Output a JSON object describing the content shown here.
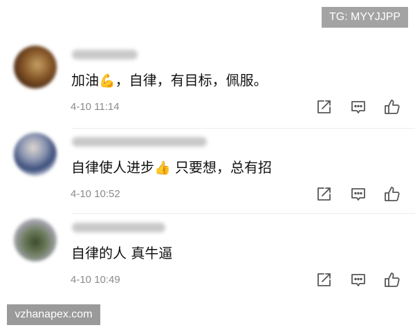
{
  "watermarks": {
    "top": "TG: MYYJJPP",
    "bottom": "vzhanapex.com"
  },
  "comments": [
    {
      "nickname": "",
      "text_before": "加油",
      "emoji": "💪",
      "text_after": "，自律，有目标，佩服。",
      "time": "4-10 11:14"
    },
    {
      "nickname": "",
      "text_before": "自律使人进步",
      "emoji": "👍",
      "text_after": " 只要想，总有招",
      "time": "4-10 10:52"
    },
    {
      "nickname": "",
      "text_before": "自律的人 真牛逼",
      "emoji": "",
      "text_after": "",
      "time": "4-10 10:49"
    }
  ],
  "icons": {
    "share": "share-edit-icon",
    "reply": "comment-icon",
    "like": "thumbs-up-icon"
  },
  "colors": {
    "watermark_bg": "#a3a3a3",
    "timestamp": "#8a8a8a",
    "icon_stroke": "#555555"
  }
}
